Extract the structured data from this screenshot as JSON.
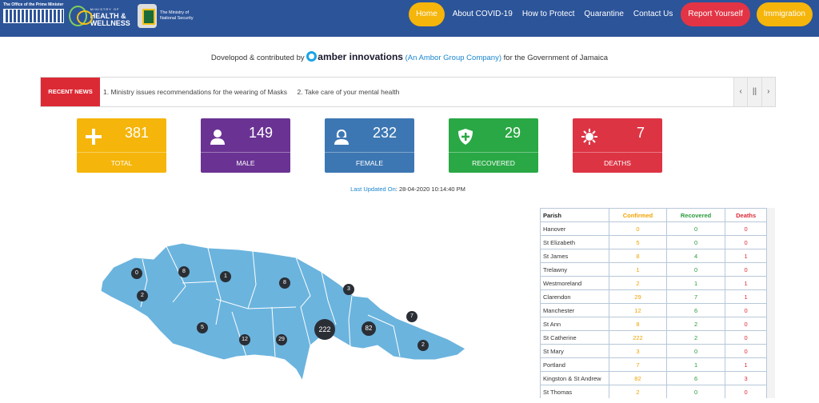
{
  "header": {
    "logo_pm_text": "The Office of the Prime Minister",
    "logo_mohw_top": "MINISTRY OF",
    "logo_mohw_main": "HEALTH & WELLNESS",
    "logo_mns_line1": "The Ministry of",
    "logo_mns_line2": "National Security",
    "nav": {
      "home": "Home",
      "about": "About COVID-19",
      "protect": "How to Protect",
      "quarantine": "Quarantine",
      "contact": "Contact Us",
      "report": "Report Yourself",
      "immigration": "Immigration"
    },
    "colors": {
      "bar": "#2c5499",
      "accent": "#f5b50a",
      "report": "#e23445"
    }
  },
  "credit": {
    "prefix": "Dovelopod & contributed by",
    "company": "amber innovations",
    "group": "(An Ambor Group Company)",
    "suffix": "for the Government of Jamaica"
  },
  "news": {
    "label": "RECENT NEWS",
    "items": [
      "1. Ministry issues recommendations for the wearing of Masks",
      "2. Take care of your mental health"
    ],
    "prev": "‹",
    "pause": "||",
    "next": "›"
  },
  "stats": {
    "total": {
      "value": "381",
      "label": "TOTAL",
      "icon": "plus-icon"
    },
    "male": {
      "value": "149",
      "label": "MALE",
      "icon": "male-user-icon"
    },
    "female": {
      "value": "232",
      "label": "FEMALE",
      "icon": "female-user-icon"
    },
    "recovered": {
      "value": "29",
      "label": "RECOVERED",
      "icon": "shield-plus-icon"
    },
    "deaths": {
      "value": "7",
      "label": "DEATHS",
      "icon": "virus-icon"
    }
  },
  "updated": {
    "label": "Last Updated On",
    "value": ": 28-04-2020 10:14:40 PM"
  },
  "map": {
    "markers": [
      {
        "parish": "Hanover",
        "value": "0"
      },
      {
        "parish": "St James",
        "value": "8"
      },
      {
        "parish": "Westmoreland",
        "value": "2"
      },
      {
        "parish": "Trelawny",
        "value": "1"
      },
      {
        "parish": "St Ann",
        "value": "8"
      },
      {
        "parish": "St Mary",
        "value": "3"
      },
      {
        "parish": "St Elizabeth",
        "value": "5"
      },
      {
        "parish": "Manchester",
        "value": "12"
      },
      {
        "parish": "Clarendon",
        "value": "29"
      },
      {
        "parish": "St Catherine",
        "value": "222"
      },
      {
        "parish": "Kingston & St Andrew",
        "value": "82"
      },
      {
        "parish": "Portland",
        "value": "7"
      },
      {
        "parish": "St Thomas",
        "value": "2"
      }
    ]
  },
  "table": {
    "headers": {
      "parish": "Parish",
      "confirmed": "Confirmed",
      "recovered": "Recovered",
      "deaths": "Deaths"
    },
    "rows": [
      {
        "parish": "Hanover",
        "confirmed": "0",
        "recovered": "0",
        "deaths": "0"
      },
      {
        "parish": "St Elizabeth",
        "confirmed": "5",
        "recovered": "0",
        "deaths": "0"
      },
      {
        "parish": "St James",
        "confirmed": "8",
        "recovered": "4",
        "deaths": "1"
      },
      {
        "parish": "Trelawny",
        "confirmed": "1",
        "recovered": "0",
        "deaths": "0"
      },
      {
        "parish": "Westmoreland",
        "confirmed": "2",
        "recovered": "1",
        "deaths": "1"
      },
      {
        "parish": "Clarendon",
        "confirmed": "29",
        "recovered": "7",
        "deaths": "1"
      },
      {
        "parish": "Manchester",
        "confirmed": "12",
        "recovered": "6",
        "deaths": "0"
      },
      {
        "parish": "St Ann",
        "confirmed": "8",
        "recovered": "2",
        "deaths": "0"
      },
      {
        "parish": "St Catherine",
        "confirmed": "222",
        "recovered": "2",
        "deaths": "0"
      },
      {
        "parish": "St Mary",
        "confirmed": "3",
        "recovered": "0",
        "deaths": "0"
      },
      {
        "parish": "Portland",
        "confirmed": "7",
        "recovered": "1",
        "deaths": "1"
      },
      {
        "parish": "Kingston & St Andrew",
        "confirmed": "82",
        "recovered": "6",
        "deaths": "3"
      },
      {
        "parish": "St Thomas",
        "confirmed": "2",
        "recovered": "0",
        "deaths": "0"
      }
    ]
  }
}
